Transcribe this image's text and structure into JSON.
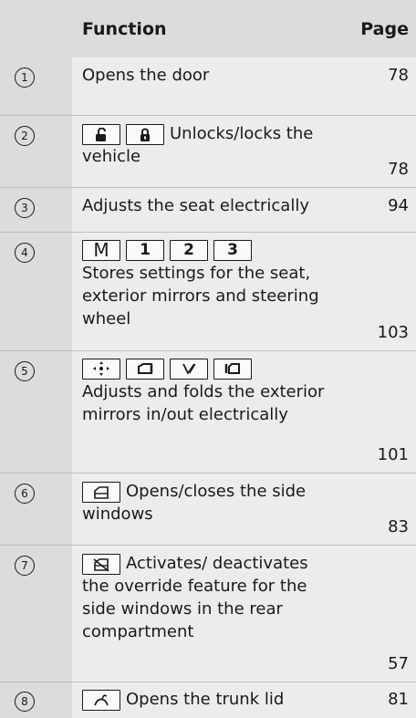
{
  "header": {
    "function": "Function",
    "page": "Page"
  },
  "rows": [
    {
      "num": "1",
      "text": "Opens the door",
      "page": "78"
    },
    {
      "num": "2",
      "text": "Unlocks/locks the vehicle",
      "page": "78",
      "keys": [
        "unlock-icon",
        "lock-icon"
      ]
    },
    {
      "num": "3",
      "text": "Adjusts the seat electrically",
      "page": "94"
    },
    {
      "num": "4",
      "keys": [
        "M",
        "1",
        "2",
        "3"
      ],
      "text": "Stores settings for the seat, exterior mirrors and steering wheel",
      "page": "103"
    },
    {
      "num": "5",
      "keys": [
        "mirror-adjust-icon",
        "left-mirror-icon",
        "fold-mirror-icon",
        "right-mirror-icon"
      ],
      "text": "Adjusts and folds the exterior mirrors in/out electrically",
      "page": "101"
    },
    {
      "num": "6",
      "text": "Opens/closes the side windows",
      "page": "83",
      "keys": [
        "window-icon"
      ]
    },
    {
      "num": "7",
      "text": "Activates/ deactivates the override feature for the side windows in the rear compartment",
      "page": "57",
      "keys": [
        "window-lock-icon"
      ]
    },
    {
      "num": "8",
      "text": "Opens the trunk lid",
      "page": "81",
      "keys": [
        "trunk-icon"
      ]
    }
  ]
}
